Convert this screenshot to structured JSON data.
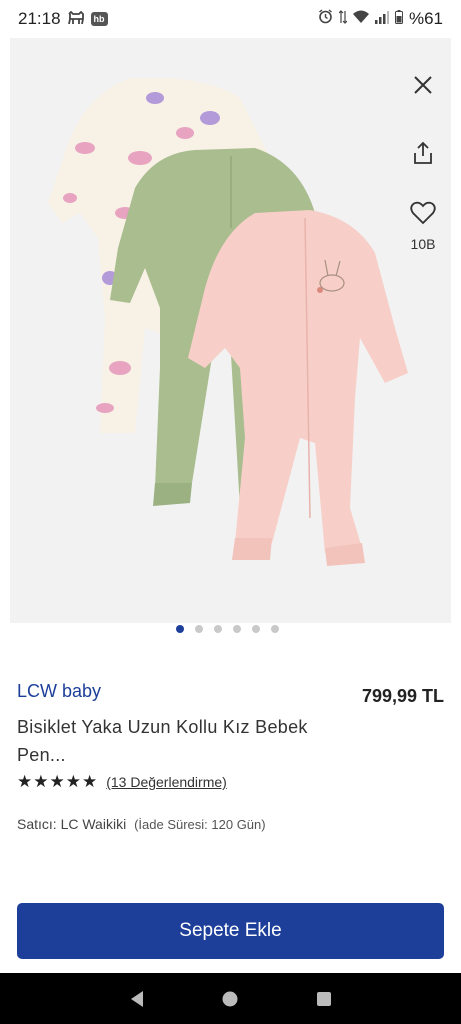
{
  "status_bar": {
    "time": "21:18",
    "hb_badge": "hb",
    "battery": "%61",
    "icons": [
      "cat-icon",
      "hb-app-icon",
      "alarm-icon",
      "wifi-icon",
      "signal-icon",
      "battery-icon"
    ]
  },
  "product": {
    "image_actions": {
      "close_icon": "close-icon",
      "share_icon": "share-icon",
      "favorite_icon": "heart-icon",
      "favorite_count": "10B"
    },
    "gallery": {
      "total": 6,
      "active_index": 0
    },
    "brand": "LCW baby",
    "price": "799,99 TL",
    "title": "Bisiklet Yaka Uzun Kollu Kız Bebek Pen...",
    "rating": {
      "stars": "★★★★★",
      "value": 5,
      "review_text": "(13 Değerlendirme)"
    },
    "seller": {
      "label": "Satıcı: ",
      "name": "LC Waikiki",
      "return_info": "(İade Süresi: 120 Gün)"
    },
    "add_to_cart_label": "Sepete Ekle"
  },
  "colors": {
    "accent": "#1d3f9a",
    "image_bg": "#f2f2f2",
    "pink": "#f7cfc8",
    "green": "#a9bd8f",
    "cream": "#f8f1e6"
  },
  "nav_bar": {
    "icons": [
      "back-icon",
      "home-icon",
      "recents-icon"
    ]
  }
}
